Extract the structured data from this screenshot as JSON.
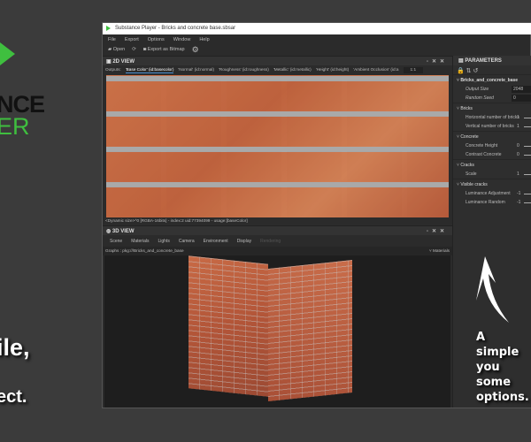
{
  "background": {
    "logo_line1": "NCE",
    "logo_line2": "ER",
    "text_line1": "ile,",
    "text_line2": "ect.",
    "note": [
      "A simple",
      "you some",
      "options."
    ]
  },
  "window": {
    "title": "Substance Player - Bricks and concrete base.sbsar",
    "menu": [
      "File",
      "Export",
      "Options",
      "Window",
      "Help"
    ],
    "toolbar": {
      "open": "Open",
      "export": "Export as Bitmap"
    },
    "view2d": {
      "title": "2D VIEW",
      "outputs_label": "Outputs:",
      "outputs": [
        "'Base Color' (id:basecolor)",
        "'Normal' (id:normal)",
        "'Roughness' (id:roughness)",
        "'Metallic' (id:metallic)",
        "'Height' (id:height)",
        "'Ambient Occlusion' (id:a"
      ],
      "zoom": "1:1",
      "status": "<Dynamic size>^0 [RGBA-16bits] - index:2 uid:77394099 - usage:[baseColor]"
    },
    "view3d": {
      "title": "3D VIEW",
      "tabs": [
        "Scene",
        "Materials",
        "Lights",
        "Camera",
        "Environment",
        "Display",
        "Rendering"
      ],
      "graphs": "Graphs :  pkg:///Bricks_and_concrete_base",
      "materials": "Materials"
    },
    "parameters": {
      "title": "PARAMETERS",
      "graph": "Bricks_and_concrete_base",
      "output_size_label": "Output Size",
      "output_size": "2048",
      "random_seed_label": "Random Seed",
      "random_seed": "0",
      "sections": [
        {
          "name": "Bricks",
          "params": [
            {
              "label": "Horizontal number of bricks",
              "value": "1"
            },
            {
              "label": "Vertical number of bricks",
              "value": "1"
            }
          ]
        },
        {
          "name": "Concrete",
          "params": [
            {
              "label": "Concrete Height",
              "value": "0"
            },
            {
              "label": "Contrast Concrete",
              "value": "0"
            }
          ]
        },
        {
          "name": "Cracks",
          "params": [
            {
              "label": "Scale",
              "value": "1"
            }
          ]
        },
        {
          "name": "Visible cracks",
          "params": [
            {
              "label": "Luminance Adjustment",
              "value": "-1"
            },
            {
              "label": "Luminance Random",
              "value": "-1"
            }
          ]
        }
      ]
    }
  }
}
